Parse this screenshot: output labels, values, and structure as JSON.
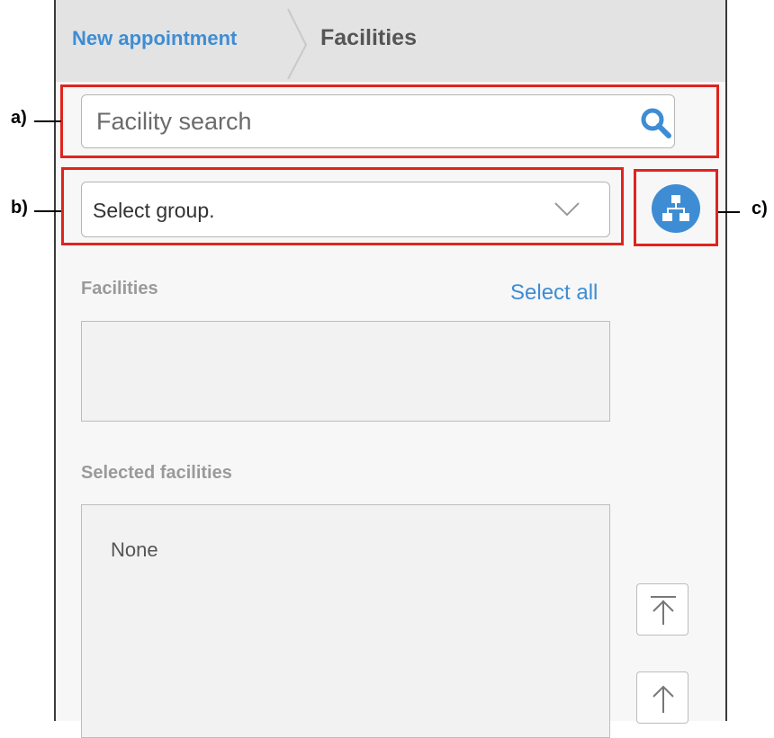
{
  "breadcrumb": {
    "parent_label": "New appointment",
    "current_label": "Facilities"
  },
  "search": {
    "placeholder": "Facility search",
    "icon": "search-icon"
  },
  "group_select": {
    "selected_value": "Select group.",
    "icon": "chevron-down-icon"
  },
  "org_button": {
    "icon": "org-chart-icon",
    "color": "#3e8dd4"
  },
  "facilities": {
    "label": "Facilities",
    "select_all_label": "Select all",
    "items": []
  },
  "selected_facilities": {
    "label": "Selected facilities",
    "empty_text": "None"
  },
  "move_buttons": {
    "top_icon": "move-to-top-icon",
    "up_icon": "move-up-icon"
  },
  "callouts": {
    "a": "a)",
    "b": "b)",
    "c": "c)"
  },
  "colors": {
    "accent": "#3e8dd4",
    "callout": "#e0241c"
  }
}
